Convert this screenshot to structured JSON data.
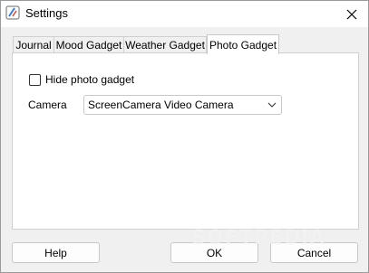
{
  "window": {
    "title": "Settings"
  },
  "tabs": [
    {
      "label": "Journal",
      "active": false
    },
    {
      "label": "Mood Gadget",
      "active": false
    },
    {
      "label": "Weather Gadget",
      "active": false
    },
    {
      "label": "Photo Gadget",
      "active": true
    }
  ],
  "photo_panel": {
    "hide_checkbox_label": "Hide photo gadget",
    "hide_checked": false,
    "camera_label": "Camera",
    "camera_value": "ScreenCamera Video Camera"
  },
  "buttons": {
    "help": "Help",
    "ok": "OK",
    "cancel": "Cancel"
  },
  "watermark": "SOFTPEDIA",
  "colors": {
    "background": "#f0f0f0",
    "panel": "#ffffff",
    "border": "#d0d0d0",
    "icon_accent": "#3b7fd4"
  },
  "icons": {
    "app": "settings-app-icon",
    "close": "close-icon",
    "dropdown": "chevron-down-icon"
  }
}
